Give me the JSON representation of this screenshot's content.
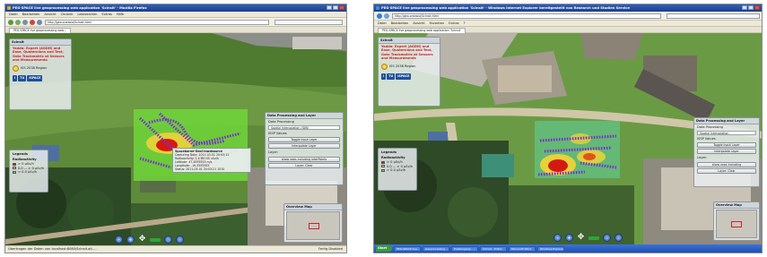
{
  "colors": {
    "title_bar": "#2f5fb8",
    "warning_text": "#d2202a",
    "heat_high": "#d41a10",
    "heat_low": "#7be03a",
    "track_points": "#7a28d8"
  },
  "screenshot_left": {
    "window_title": "PEG-SPACE live geoprocessing web application 'ScInsit' - Mozilla Firefox",
    "menu": [
      "Datei",
      "Bearbeiten",
      "Ansicht",
      "Chronik",
      "Lesezeichen",
      "Extras",
      "Hilfe"
    ],
    "url": "http://geo.oneasia/ScInsit.html",
    "tab_label": "PEG-SPACE live geoprocessing web...",
    "intro_panel": {
      "header": "ScInsit",
      "warning": "Yadda: Expert (AGDH) and Ease, Quaternions and Test, Goto Trackmatrix at Sensors and Measurements",
      "region_label": "ISS 2038 Region",
      "logos": [
        "i",
        "TU",
        "iSPACE"
      ]
    },
    "legend": {
      "title": "Legends",
      "subtitle": "Radioactivity",
      "items": [
        "> 0 µSv/h",
        "0.0 ... > 0 µSv/h",
        "> 0.0 µSv/h"
      ]
    },
    "popup": {
      "title": "Spaceborne-GeoCrowdsource",
      "lines": [
        "Capturing Date: 2011-03-01 20:03:11",
        "Radioactivity: 1.4 MS NS uSv/h",
        "Latitude: 47.4555555 m/s",
        "Longitude: -19.3555555",
        "Status: 2011-03-01 20:03:21 1010"
      ]
    },
    "processing_panel": {
      "header": "Data Processing and Layer",
      "section_label": "Data Processing",
      "select_value": "Spatial Interpolation (IDW)",
      "field_label": "ISSP Values",
      "buttons": [
        "Toggle Input Layer",
        "Interpolate Layer"
      ],
      "layer_label": "Layer:",
      "layer_buttons": [
        "show rows including interPoints",
        "Layer: Clear"
      ]
    },
    "overview_title": "Overview Map",
    "status_text": "Übertragen der Daten von localhost:8080/ScInsit.at/.....",
    "status_right": "Fertig  Disabled"
  },
  "screenshot_right": {
    "window_title": "PEG-SPACE live geoprocessing web application 'ScInsit' - Windows Internet Explorer bereitgestellt von Research und Studien Service",
    "menu": [
      "Datei",
      "Bearbeiten",
      "Ansicht",
      "Favoriten",
      "Extras",
      "?"
    ],
    "url": "http://geo.oneasia/ScInsit.html",
    "tab_label": "PEG-SPACE live geoprocessing web application 'ScInsit'",
    "intro_panel": {
      "header": "ScInsit",
      "warning": "Yadda: Expert (AGDH) and Ease, Quaternions and Test, Goto Trackmatrix at Sensors and Measurements",
      "region_label": "ISS 2038 Region",
      "logos": [
        "i",
        "TU",
        "iSPACE"
      ]
    },
    "legend": {
      "title": "Legends",
      "subtitle": "Radioactivity",
      "items": [
        "> 0 µSv/h",
        "0.0 ... > 0 µSv/h",
        "> 0.0 µSv/h"
      ]
    },
    "processing_panel": {
      "header": "Data Processing and Layer",
      "section_label": "Data Processing",
      "select_value": "Spatial Interpolation",
      "field_label": "ISSP Values",
      "buttons": [
        "Toggle Input Layer",
        "Interpolate Layer"
      ],
      "layer_label": "Layer:",
      "layer_buttons": [
        "show rows including",
        "Layer: Clear"
      ]
    },
    "overview_title": "Overview Map",
    "taskbar_start": "Start",
    "taskbar_items": [
      "PEG-SPACE live...",
      "Geoprocessing ...",
      "Posteingang - ...",
      "ScInsit - Editor",
      "Microsoft Word",
      "Windows Explorer"
    ]
  }
}
